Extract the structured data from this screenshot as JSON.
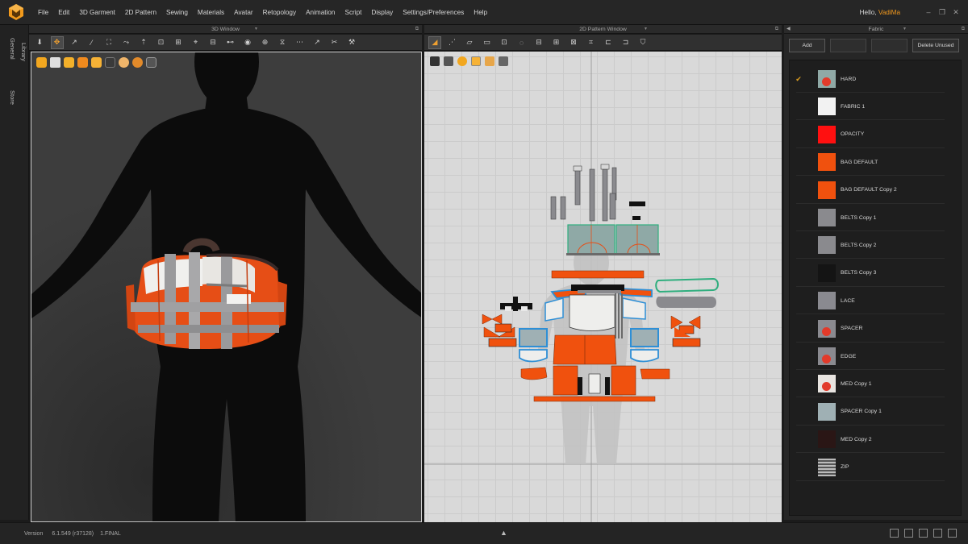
{
  "menu": {
    "items": [
      "File",
      "Edit",
      "3D Garment",
      "2D Pattern",
      "Sewing",
      "Materials",
      "Avatar",
      "Retopology",
      "Animation",
      "Script",
      "Display",
      "Settings/Preferences",
      "Help"
    ],
    "greeting": "Hello, ",
    "username": "VadiMa"
  },
  "left_tabs": [
    "Library",
    "General",
    "Store"
  ],
  "panels": {
    "window3d_title": "3D Window",
    "window2d_title": "2D Pattern Window",
    "fabric_title": "Fabric"
  },
  "fabric": {
    "buttons": {
      "add": "Add",
      "delete_unused": "Delete Unused"
    },
    "items": [
      {
        "name": "HARD",
        "color": "#8fa9a6",
        "checked": true,
        "icon": "logo-swatch"
      },
      {
        "name": "FABRIC 1",
        "color": "#f2f2f2",
        "checked": false
      },
      {
        "name": "OPACITY",
        "color": "#ff1010",
        "checked": false
      },
      {
        "name": "BAG DEFAULT",
        "color": "#f0510e",
        "checked": false
      },
      {
        "name": "BAG DEFAULT Copy 2",
        "color": "#f0510e",
        "checked": false
      },
      {
        "name": "BELTS Copy 1",
        "color": "#8a8a8e",
        "checked": false
      },
      {
        "name": "BELTS Copy 2",
        "color": "#8a8a8e",
        "checked": false
      },
      {
        "name": "BELTS Copy 3",
        "color": "#141414",
        "checked": false
      },
      {
        "name": "LACE",
        "color": "#8a8a90",
        "checked": false
      },
      {
        "name": "SPACER",
        "color": "#8a8a90",
        "checked": false,
        "icon": "logo-swatch"
      },
      {
        "name": "EDGE",
        "color": "#8a8a90",
        "checked": false,
        "icon": "logo-swatch"
      },
      {
        "name": "MED Copy 1",
        "color": "#e8e4e0",
        "checked": false,
        "icon": "logo-swatch"
      },
      {
        "name": "SPACER Copy 1",
        "color": "#9fb0b4",
        "checked": false
      },
      {
        "name": "MED Copy 2",
        "color": "#2a1615",
        "checked": false
      },
      {
        "name": "ZIP",
        "color": "#777777",
        "checked": false,
        "icon": "zipper-swatch"
      }
    ]
  },
  "status": {
    "version_label": "Version",
    "version_number": "6.1.549 (r37128)",
    "build": "1.FINAL"
  },
  "colors": {
    "accent": "#f39a1e",
    "bag_orange": "#f0510e",
    "panel_bg": "#262626"
  }
}
